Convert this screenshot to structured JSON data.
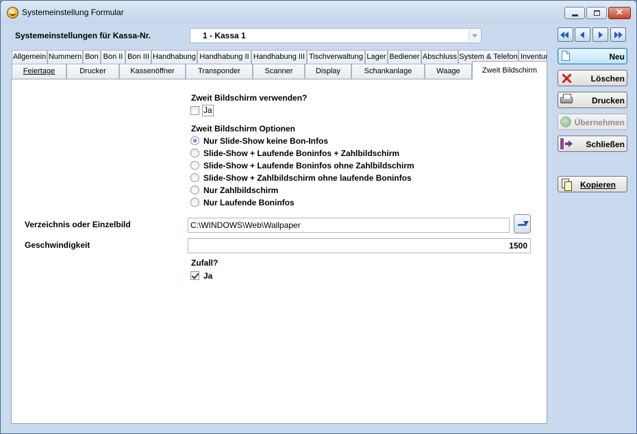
{
  "window": {
    "title": "Systemeinstellung Formular"
  },
  "kassa": {
    "label": "Systemeinstellungen für Kassa-Nr.",
    "value": "1 - Kassa 1"
  },
  "tabs_row1": [
    "Allgemein",
    "Nummern",
    "Bon",
    "Bon II",
    "Bon III",
    "Handhabung",
    "Handhabung II",
    "Handhabung III",
    "Tischverwaltung",
    "Lager",
    "Bediener",
    "Abschluss",
    "System & Telefon",
    "Inventur"
  ],
  "tabs_row2": [
    "Feiertage",
    "Drucker",
    "Kassenöffner",
    "Transponder",
    "Scanner",
    "Display",
    "Schankanlage",
    "Waage",
    "Zweit Bildschirm"
  ],
  "active_tab": "Zweit Bildschirm",
  "panel": {
    "use_heading": "Zweit Bildschirm verwenden?",
    "use_label": "Ja",
    "use_checked": false,
    "options_heading": "Zweit Bildschirm Optionen",
    "options": [
      "Nur Slide-Show keine Bon-Infos",
      "Slide-Show + Laufende Boninfos + Zahlbildschirm",
      "Slide-Show + Laufende Boninfos ohne Zahlbildschirm",
      "Slide-Show + Zahlbildschirm ohne laufende Boninfos",
      "Nur Zahlbildschirm",
      "Nur Laufende Boninfos"
    ],
    "selected_option": 0,
    "directory_label": "Verzeichnis oder Einzelbild",
    "directory_value": "C:\\WINDOWS\\Web\\Wallpaper",
    "speed_label": "Geschwindigkeit",
    "speed_value": "1500",
    "random_heading": "Zufall?",
    "random_label": "Ja",
    "random_checked": true
  },
  "sidebar": {
    "new": "Neu",
    "delete": "Löschen",
    "print": "Drucken",
    "apply": "Übernehmen",
    "close": "Schließen",
    "copy": "Kopieren"
  }
}
